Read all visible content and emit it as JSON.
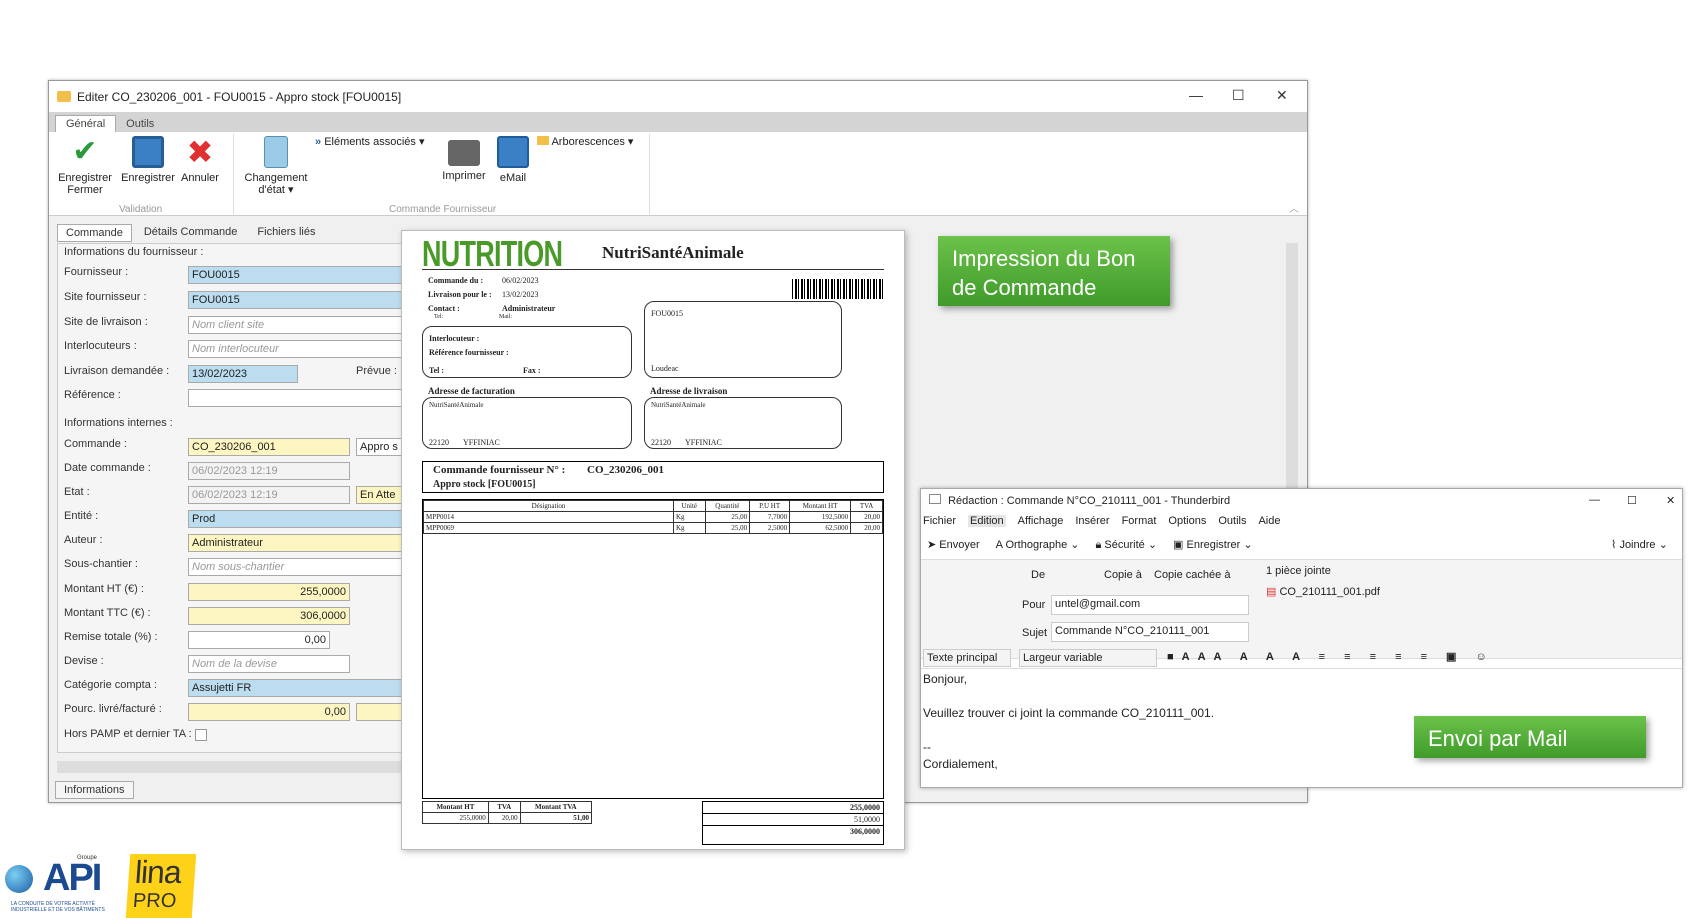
{
  "window": {
    "title": "Editer CO_230206_001 - FOU0015 - Appro stock [FOU0015]",
    "min": "—",
    "max": "☐",
    "close": "✕"
  },
  "tabs": [
    "Général",
    "Outils"
  ],
  "ribbon": {
    "save_close": "Enregistrer\nFermer",
    "save": "Enregistrer",
    "cancel": "Annuler",
    "change_state": "Changement\nd'état ▾",
    "linked": "Eléments associés ▾",
    "print": "Imprimer",
    "email": "eMail",
    "trees": "Arborescences ▾",
    "group_validation": "Validation",
    "group_order": "Commande Fournisseur"
  },
  "subtabs": [
    "Commande",
    "Détails Commande",
    "Fichiers liés"
  ],
  "form": {
    "supplier_section": "Informations du fournisseur :",
    "fournisseur_label": "Fournisseur :",
    "fournisseur_value": "FOU0015",
    "site_label": "Site fournisseur :",
    "site_value": "FOU0015",
    "livraison_label": "Site de livraison :",
    "livraison_ph": "Nom client site",
    "interloc_label": "Interlocuteurs :",
    "interloc_ph": "Nom interlocuteur",
    "liv_dem_label": "Livraison demandée :",
    "liv_dem_value": "13/02/2023",
    "prevue_label": "Prévue :",
    "ref_label": "Référence :",
    "internal_section": "Informations internes :",
    "commande_label": "Commande :",
    "commande_value": "CO_230206_001",
    "commande_extra": "Appro s",
    "date_label": "Date commande :",
    "date_value": "06/02/2023 12:19",
    "etat_label": "Etat :",
    "etat_value": "06/02/2023 12:19",
    "etat_extra": "En Atte",
    "entite_label": "Entité :",
    "entite_value": "Prod",
    "auteur_label": "Auteur :",
    "auteur_value": "Administrateur",
    "sous_label": "Sous-chantier :",
    "sous_ph": "Nom sous-chantier",
    "ht_label": "Montant HT (€) :",
    "ht_value": "255,0000",
    "ttc_label": "Montant TTC (€) :",
    "ttc_value": "306,0000",
    "remise_label": "Remise totale (%) :",
    "remise_value": "0,00",
    "devise_label": "Devise :",
    "devise_ph": "Nom de la devise",
    "categ_label": "Catégorie compta :",
    "categ_value": "Assujetti FR",
    "pourc_label": "Pourc. livré/facturé :",
    "pourc_value": "0,00",
    "pamp_label": "Hors PAMP et dernier TA :"
  },
  "bottom_tab": "Informations",
  "doc": {
    "logo": "NUTRITION",
    "company": "NutriSantéAnimale",
    "cmd_du": "Commande du :",
    "cmd_du_v": "06/02/2023",
    "liv_pour": "Livraison pour le :",
    "liv_pour_v": "13/02/2023",
    "contact": "Contact :",
    "contact_v": "Administrateur",
    "tel": "Tel:",
    "mail": "Mail:",
    "interloc": "Interlocuteur :",
    "ref_f": "Référence fournisseur :",
    "tel2": "Tel :",
    "fax": "Fax :",
    "sup_code": "FOU0015",
    "sup_city": "Loudeac",
    "bill_title": "Adresse de facturation",
    "ship_title": "Adresse de livraison",
    "bill_name": "NutriSantéAnimale",
    "bill_cp": "22120",
    "bill_city": "YFFINIAC",
    "ship_name": "NutriSantéAnimale",
    "ship_cp": "22120",
    "ship_city": "YFFINIAC",
    "order_title": "Commande fournisseur N° :",
    "order_no": "CO_230206_001",
    "order_sub": "Appro stock [FOU0015]",
    "headers": [
      "Désignation",
      "Unité",
      "Quantité",
      "P.U HT",
      "Montant HT",
      "TVA"
    ],
    "rows": [
      [
        "MPP0014",
        "Kg",
        "25,00",
        "7,7000",
        "192,5000",
        "20,00"
      ],
      [
        "MPP0069",
        "Kg",
        "25,00",
        "2,5000",
        "62,5000",
        "20,00"
      ]
    ],
    "tot_headers": [
      "Montant HT",
      "TVA",
      "Montant TVA"
    ],
    "tot_row": [
      "255,0000",
      "20,00",
      "51,00"
    ],
    "totals": [
      "255,0000",
      "51,0000",
      "306,0000"
    ]
  },
  "callouts": {
    "print": "Impression du Bon\nde Commande",
    "mail": "Envoi par Mail"
  },
  "tb": {
    "title": "Rédaction : Commande N°CO_210111_001 - Thunderbird",
    "menu": [
      "Fichier",
      "Edition",
      "Affichage",
      "Insérer",
      "Format",
      "Options",
      "Outils",
      "Aide"
    ],
    "toolbar": [
      "Envoyer",
      "Orthographe",
      "Sécurité",
      "Enregistrer"
    ],
    "attach_btn": "Joindre",
    "de": "De",
    "copie": "Copie à",
    "copie_cachee": "Copie cachée à",
    "pour": "Pour",
    "pour_value": "untel@gmail.com",
    "sujet": "Sujet",
    "sujet_value": "Commande N°CO_210111_001",
    "attach_count": "1 pièce jointe",
    "attach_file": "CO_210111_001.pdf",
    "format": "Texte principal",
    "width": "Largeur variable",
    "body": [
      "Bonjour,",
      "",
      "Veuillez trouver ci joint la commande CO_210111_001.",
      "",
      "--",
      "Cordialement,"
    ]
  },
  "logos": {
    "api": "API",
    "api_small": "Groupe",
    "api_tag": "LA CONDUITE DE VOTRE ACTIVITÉ\nINDUSTRIELLE ET DE VOS BÂTIMENTS",
    "lina": "lina",
    "pro": "PRO"
  }
}
